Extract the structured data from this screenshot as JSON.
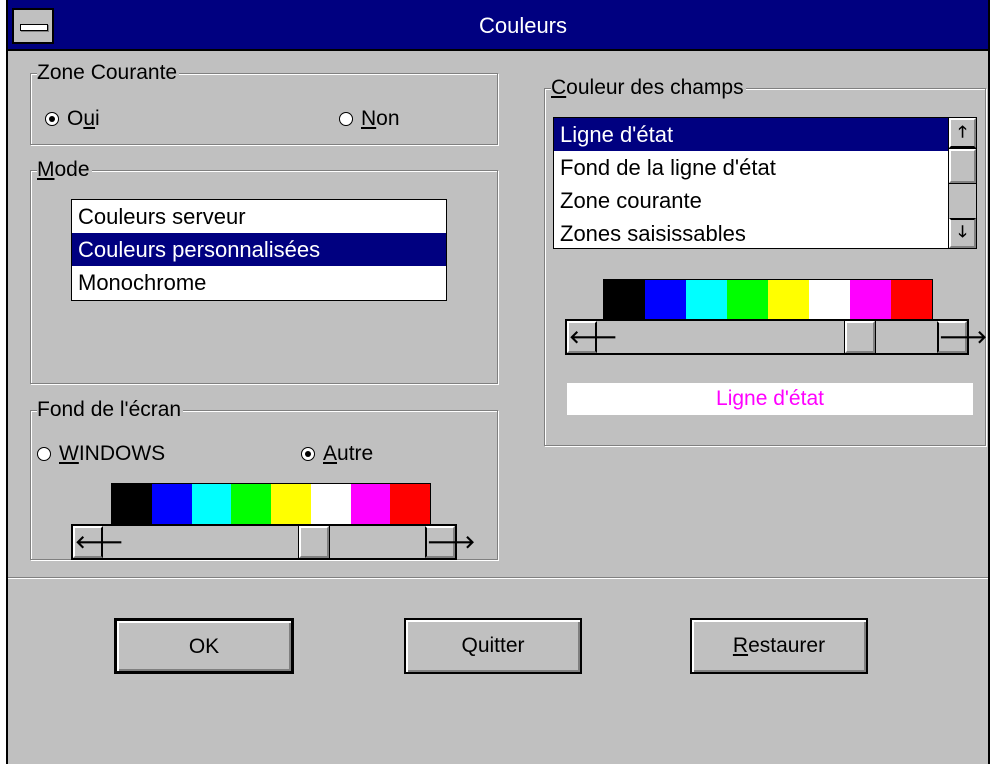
{
  "window": {
    "title": "Couleurs"
  },
  "zone_courante": {
    "label": "Zone Courante",
    "options": [
      {
        "label_u": "O",
        "label_underlined": "u",
        "label_rest": "i",
        "selected": true
      },
      {
        "label_u": "",
        "label_underlined": "N",
        "label_rest": "on",
        "selected": false
      }
    ]
  },
  "mode": {
    "label_underlined": "M",
    "label_rest": "ode",
    "items": [
      "Couleurs serveur",
      "Couleurs personnalisées",
      "Monochrome"
    ],
    "selected_index": 1
  },
  "fond_ecran": {
    "label": "Fond de l'écran",
    "options": [
      {
        "label_underlined": "W",
        "label_rest": "INDOWS",
        "selected": false
      },
      {
        "label_underlined": "A",
        "label_rest": "utre",
        "selected": true
      }
    ],
    "scroll_position": 0.67
  },
  "couleur_champs": {
    "label_underlined": "C",
    "label_rest": "ouleur des champs",
    "items": [
      "Ligne d'état",
      "Fond de la ligne d'état",
      "Zone courante",
      "Zones saisissables"
    ],
    "selected_index": 0,
    "scroll_position": 0.8,
    "preview_text": "Ligne d'état",
    "preview_color": "#ff00ff"
  },
  "palette": [
    "#000000",
    "#0000ff",
    "#00ffff",
    "#00ff00",
    "#ffff00",
    "#ffffff",
    "#ff00ff",
    "#ff0000"
  ],
  "buttons": {
    "ok": "OK",
    "quitter": "Quitter",
    "restaurer_underlined": "R",
    "restaurer_rest": "estaurer"
  },
  "icons": {
    "arrow_left": "🡐",
    "arrow_right": "🡒",
    "arrow_up": "🡑",
    "arrow_down": "🡓"
  },
  "colors": {
    "selection": "#000080",
    "face": "#c0c0c0"
  }
}
